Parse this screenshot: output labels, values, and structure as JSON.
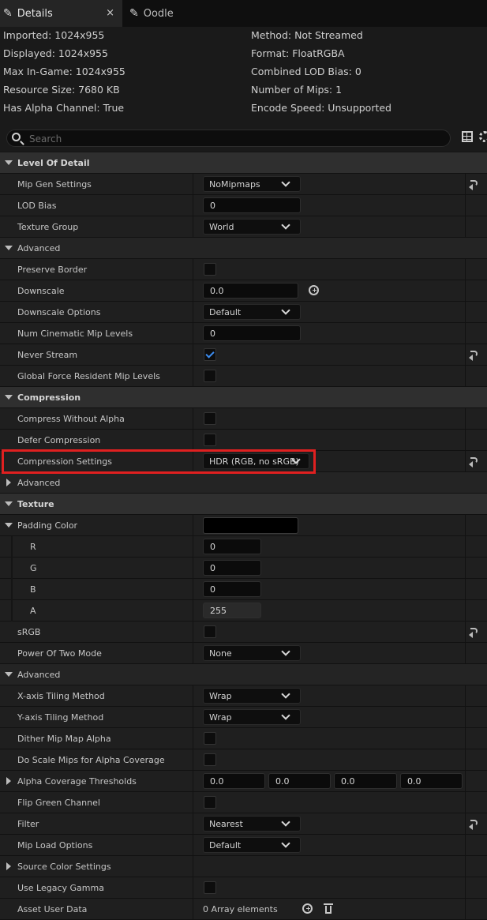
{
  "tabs": [
    {
      "label": "Details",
      "close": "×"
    },
    {
      "label": "Oodle"
    }
  ],
  "info": {
    "left": [
      "Imported: 1024x955",
      "Displayed: 1024x955",
      "Max In-Game: 1024x955",
      "Resource Size: 7680 KB",
      "Has Alpha Channel: True"
    ],
    "right": [
      "Method: Not Streamed",
      "Format: FloatRGBA",
      "Combined LOD Bias: 0",
      "Number of Mips: 1",
      "Encode Speed: Unsupported"
    ]
  },
  "search": {
    "placeholder": "Search"
  },
  "rows": {
    "lod": {
      "label": "Level Of Detail"
    },
    "mipgen": {
      "label": "Mip Gen Settings",
      "value": "NoMipmaps"
    },
    "lodbias": {
      "label": "LOD Bias",
      "value": "0"
    },
    "texgroup": {
      "label": "Texture Group",
      "value": "World"
    },
    "adv1": {
      "label": "Advanced"
    },
    "preserve": {
      "label": "Preserve Border"
    },
    "downscale": {
      "label": "Downscale",
      "value": "0.0"
    },
    "downopt": {
      "label": "Downscale Options",
      "value": "Default"
    },
    "numcine": {
      "label": "Num Cinematic Mip Levels",
      "value": "0"
    },
    "neverstream": {
      "label": "Never Stream"
    },
    "globalforce": {
      "label": "Global Force Resident Mip Levels"
    },
    "compression": {
      "label": "Compression"
    },
    "compwoalpha": {
      "label": "Compress Without Alpha"
    },
    "defer": {
      "label": "Defer Compression"
    },
    "compsettings": {
      "label": "Compression Settings",
      "value": "HDR (RGB, no sRGB)"
    },
    "adv2": {
      "label": "Advanced"
    },
    "texture": {
      "label": "Texture"
    },
    "padding": {
      "label": "Padding Color"
    },
    "r": {
      "label": "R",
      "value": "0"
    },
    "g": {
      "label": "G",
      "value": "0"
    },
    "b": {
      "label": "B",
      "value": "0"
    },
    "a": {
      "label": "A",
      "value": "255"
    },
    "srgb": {
      "label": "sRGB"
    },
    "pow2": {
      "label": "Power Of Two Mode",
      "value": "None"
    },
    "adv3": {
      "label": "Advanced"
    },
    "xtile": {
      "label": "X-axis Tiling Method",
      "value": "Wrap"
    },
    "ytile": {
      "label": "Y-axis Tiling Method",
      "value": "Wrap"
    },
    "dither": {
      "label": "Dither Mip Map Alpha"
    },
    "doscale": {
      "label": "Do Scale Mips for Alpha Coverage"
    },
    "alphacov": {
      "label": "Alpha Coverage Thresholds",
      "values": [
        "0.0",
        "0.0",
        "0.0",
        "0.0"
      ]
    },
    "flipgreen": {
      "label": "Flip Green Channel"
    },
    "filter": {
      "label": "Filter",
      "value": "Nearest"
    },
    "mipload": {
      "label": "Mip Load Options",
      "value": "Default"
    },
    "sourcecolor": {
      "label": "Source Color Settings"
    },
    "legacy": {
      "label": "Use Legacy Gamma"
    },
    "assetuser": {
      "label": "Asset User Data",
      "value": "0 Array elements"
    }
  },
  "colors": {
    "highlight": "#e02020",
    "check": "#3d8df0",
    "padding_color": "#000000"
  }
}
